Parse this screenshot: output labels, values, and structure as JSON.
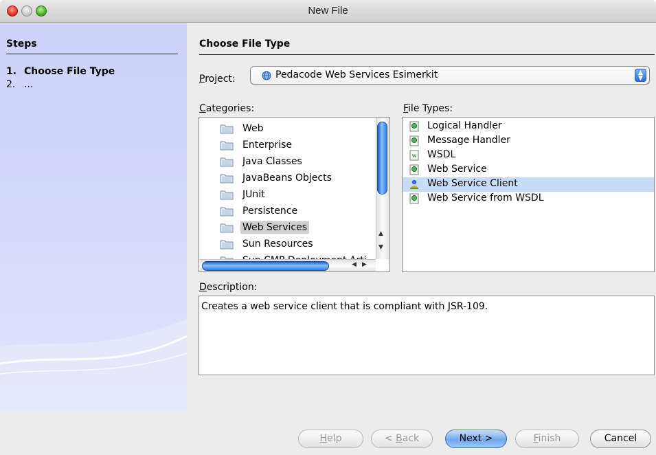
{
  "window": {
    "title": "New File"
  },
  "steps": {
    "title": "Steps",
    "items": [
      {
        "number": "1.",
        "label": "Choose File Type"
      },
      {
        "number": "2.",
        "label": "..."
      }
    ]
  },
  "main": {
    "title": "Choose File Type",
    "project": {
      "label_accel": "P",
      "label_rest": "roject:",
      "value": "Pedacode Web Services Esimerkit"
    },
    "categories": {
      "label_accel": "C",
      "label_rest": "ategories:",
      "items": [
        "Web",
        "Enterprise",
        "Java Classes",
        "JavaBeans Objects",
        "JUnit",
        "Persistence",
        "Web Services",
        "Sun Resources",
        "Sun CMP Deployment Arti"
      ],
      "selected": "Web Services"
    },
    "file_types": {
      "label_accel": "F",
      "label_rest": "ile Types:",
      "items": [
        "Logical Handler",
        "Message Handler",
        "WSDL",
        "Web Service",
        "Web Service Client",
        "Web Service from WSDL"
      ],
      "selected": "Web Service Client"
    },
    "description": {
      "label_accel": "D",
      "label_rest": "escription:",
      "text": "Creates a web service client that is compliant with JSR-109."
    }
  },
  "buttons": {
    "help_accel": "H",
    "help_rest": "elp",
    "back_prefix": "< ",
    "back_accel": "B",
    "back_rest": "ack",
    "next": "Next >",
    "finish_accel": "F",
    "finish_rest": "inish",
    "cancel": "Cancel"
  },
  "colors": {
    "steps_panel": "#d4d7fb",
    "selection": "#c6dcf7",
    "scroll_thumb": "#2f78dd"
  }
}
